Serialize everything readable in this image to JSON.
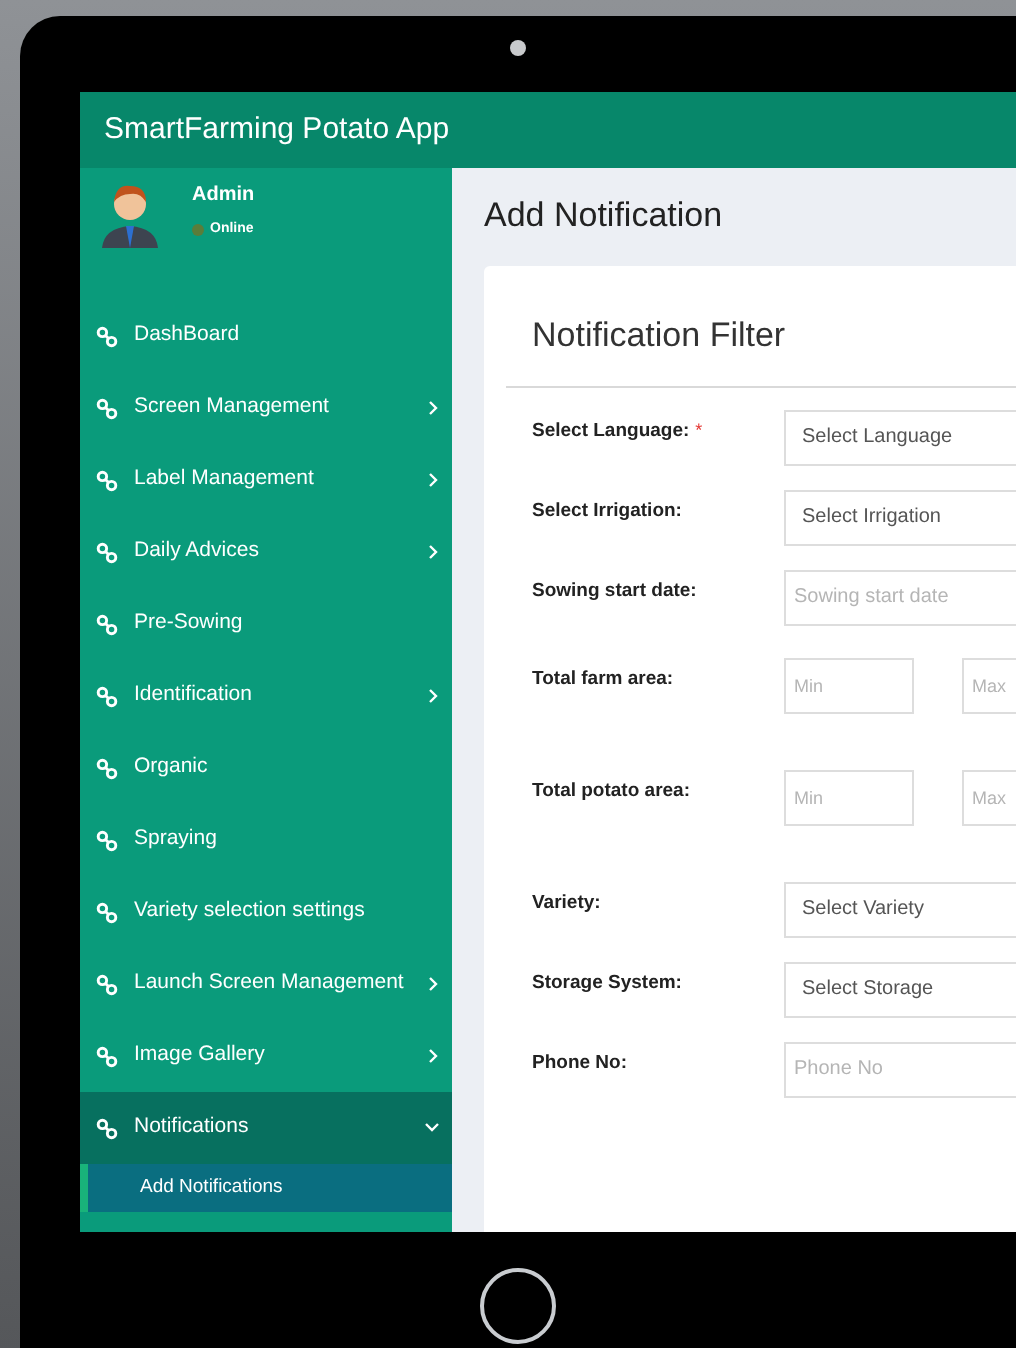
{
  "app_title": "SmartFarming Potato App",
  "user": {
    "name": "Admin",
    "status": "Online",
    "online": true
  },
  "sidebar": {
    "items": [
      {
        "label": "DashBoard",
        "has_submenu": false,
        "expanded": false
      },
      {
        "label": "Screen Management",
        "has_submenu": true,
        "expanded": false
      },
      {
        "label": "Label Management",
        "has_submenu": true,
        "expanded": false
      },
      {
        "label": "Daily Advices",
        "has_submenu": true,
        "expanded": false
      },
      {
        "label": "Pre-Sowing",
        "has_submenu": false,
        "expanded": false
      },
      {
        "label": "Identification",
        "has_submenu": true,
        "expanded": false
      },
      {
        "label": "Organic",
        "has_submenu": false,
        "expanded": false
      },
      {
        "label": "Spraying",
        "has_submenu": false,
        "expanded": false
      },
      {
        "label": "Variety selection settings",
        "has_submenu": false,
        "expanded": false
      },
      {
        "label": "Launch Screen Management",
        "has_submenu": true,
        "expanded": false
      },
      {
        "label": "Image Gallery",
        "has_submenu": true,
        "expanded": false
      },
      {
        "label": "Notifications",
        "has_submenu": true,
        "expanded": true,
        "children": [
          {
            "label": "Add Notifications",
            "selected": true
          }
        ]
      }
    ]
  },
  "page_title": "Add Notification",
  "card_title": "Notification Filter",
  "fields": [
    {
      "kind": "select",
      "label": "Select Language:",
      "required": true,
      "required_mark": "*",
      "placeholder": "Select Language"
    },
    {
      "kind": "select",
      "label": "Select Irrigation:",
      "required": false,
      "placeholder": "Select Irrigation"
    },
    {
      "kind": "input",
      "label": "Sowing start date:",
      "required": false,
      "placeholder": "Sowing start date"
    },
    {
      "kind": "range",
      "label": "Total farm area:",
      "required": false,
      "min_placeholder": "Min",
      "max_placeholder": "Max"
    },
    {
      "kind": "range",
      "label": "Total potato area:",
      "required": false,
      "min_placeholder": "Min",
      "max_placeholder": "Max"
    },
    {
      "kind": "select",
      "label": "Variety:",
      "required": false,
      "placeholder": "Select Variety"
    },
    {
      "kind": "select",
      "label": "Storage System:",
      "required": false,
      "placeholder": "Select Storage"
    },
    {
      "kind": "input",
      "label": "Phone No:",
      "required": false,
      "placeholder": "Phone No"
    }
  ]
}
